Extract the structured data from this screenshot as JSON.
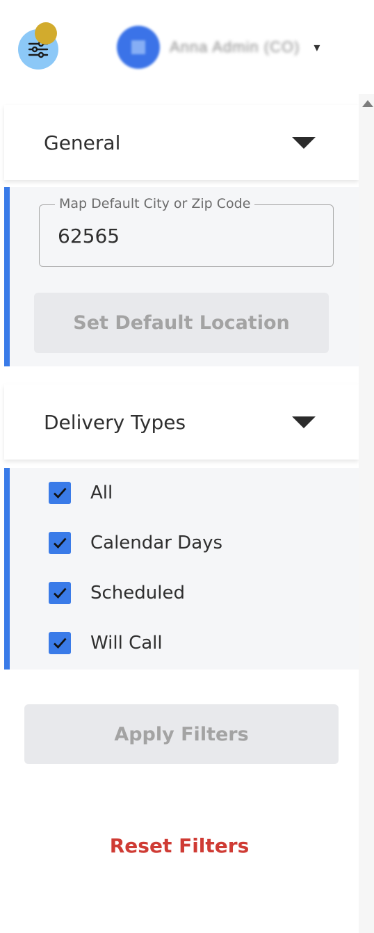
{
  "header": {
    "user_name": "Anna Admin (CO)",
    "user_caret": "▾"
  },
  "sections": {
    "general": {
      "title": "General",
      "field_label": "Map Default City or Zip Code",
      "field_value": "62565",
      "button_label": "Set Default Location"
    },
    "delivery_types": {
      "title": "Delivery Types",
      "options": [
        {
          "label": "All",
          "checked": true
        },
        {
          "label": "Calendar Days",
          "checked": true
        },
        {
          "label": "Scheduled",
          "checked": true
        },
        {
          "label": "Will Call",
          "checked": true
        }
      ]
    }
  },
  "actions": {
    "apply_label": "Apply Filters",
    "reset_label": "Reset Filters"
  },
  "colors": {
    "accent": "#3a7be8",
    "filter_button": "#8cc8f7",
    "badge": "#d2ab2d",
    "danger": "#cf3b34"
  },
  "icons": {
    "filter": "sliders-icon",
    "check": "check-icon",
    "expand": "caret-down-icon"
  }
}
